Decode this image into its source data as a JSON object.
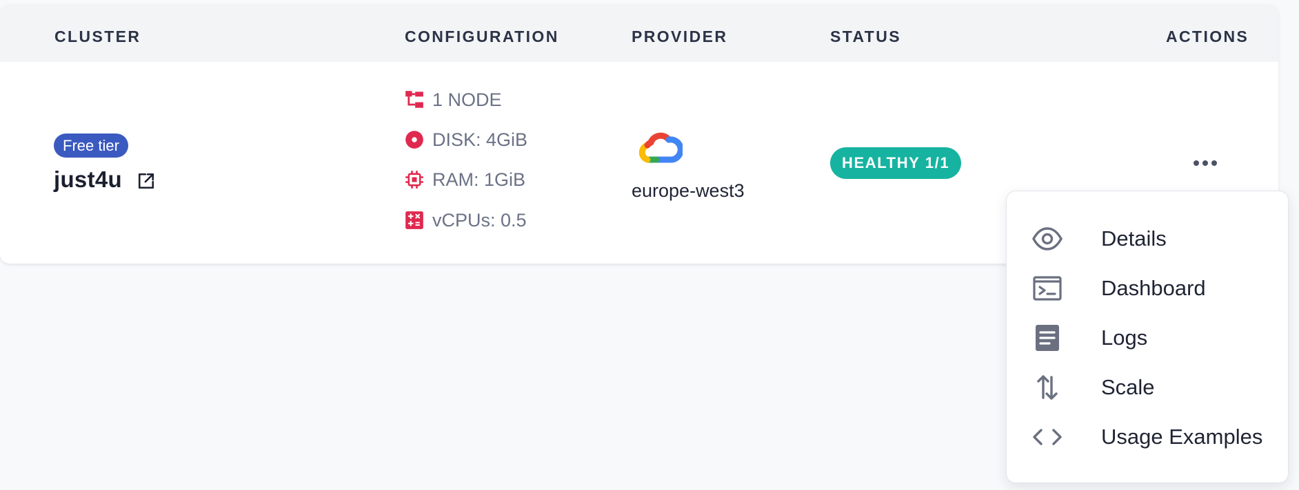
{
  "table": {
    "headers": {
      "cluster": "CLUSTER",
      "configuration": "CONFIGURATION",
      "provider": "PROVIDER",
      "status": "STATUS",
      "actions": "ACTIONS"
    },
    "row": {
      "tier_badge": "Free tier",
      "cluster_name": "just4u",
      "specs": {
        "nodes": "1 NODE",
        "disk": "DISK: 4GiB",
        "ram": "RAM: 1GiB",
        "vcpus": "vCPUs: 0.5"
      },
      "provider_icon": "google-cloud-icon",
      "region": "europe-west3",
      "status": "HEALTHY 1/1"
    }
  },
  "menu": {
    "items": [
      {
        "label": "Details",
        "icon": "eye-icon"
      },
      {
        "label": "Dashboard",
        "icon": "terminal-icon"
      },
      {
        "label": "Logs",
        "icon": "document-icon"
      },
      {
        "label": "Scale",
        "icon": "arrows-up-down-icon"
      },
      {
        "label": "Usage Examples",
        "icon": "code-icon"
      }
    ]
  },
  "colors": {
    "tier_badge": "#3b5ac0",
    "status_healthy": "#16b3a0",
    "spec_icon": "#e0294f",
    "header_bg": "#f3f4f6",
    "page_bg": "#f8f9fb"
  }
}
